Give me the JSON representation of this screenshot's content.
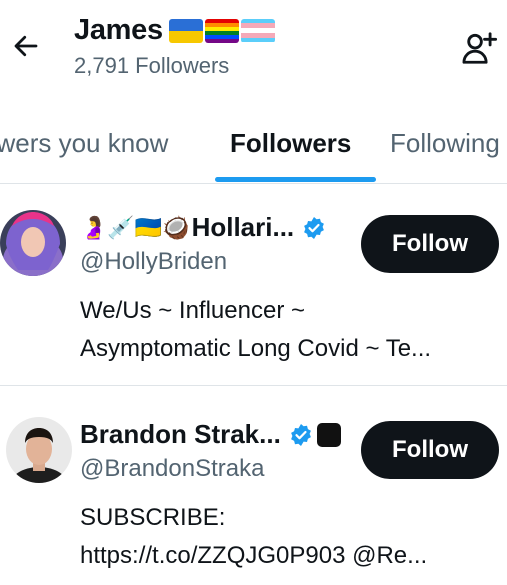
{
  "header": {
    "title": "James",
    "subtitle": "2,791 Followers",
    "flag_icons": [
      "ukraine-flag-icon",
      "rainbow-flag-icon",
      "transgender-flag-icon"
    ]
  },
  "tabs": [
    {
      "label": "owers you know",
      "active": false
    },
    {
      "label": "Followers",
      "active": true
    },
    {
      "label": "Following",
      "active": false
    }
  ],
  "accent_color": "#1d9bf0",
  "users": [
    {
      "emoji_prefix": "🤰💉🇺🇦🥥",
      "display_name": "Hollari...",
      "handle": "@HollyBriden",
      "bio": [
        "We/Us ~ Influencer ~",
        "Asymptomatic Long Covid ~ Te..."
      ],
      "verified": true,
      "follow_label": "Follow"
    },
    {
      "emoji_prefix": "",
      "display_name": "Brandon Strak...",
      "handle": "@BrandonStraka",
      "bio": [
        "SUBSCRIBE:",
        "https://t.co/ZZQJG0P903 @Re..."
      ],
      "verified": true,
      "follow_label": "Follow"
    }
  ]
}
